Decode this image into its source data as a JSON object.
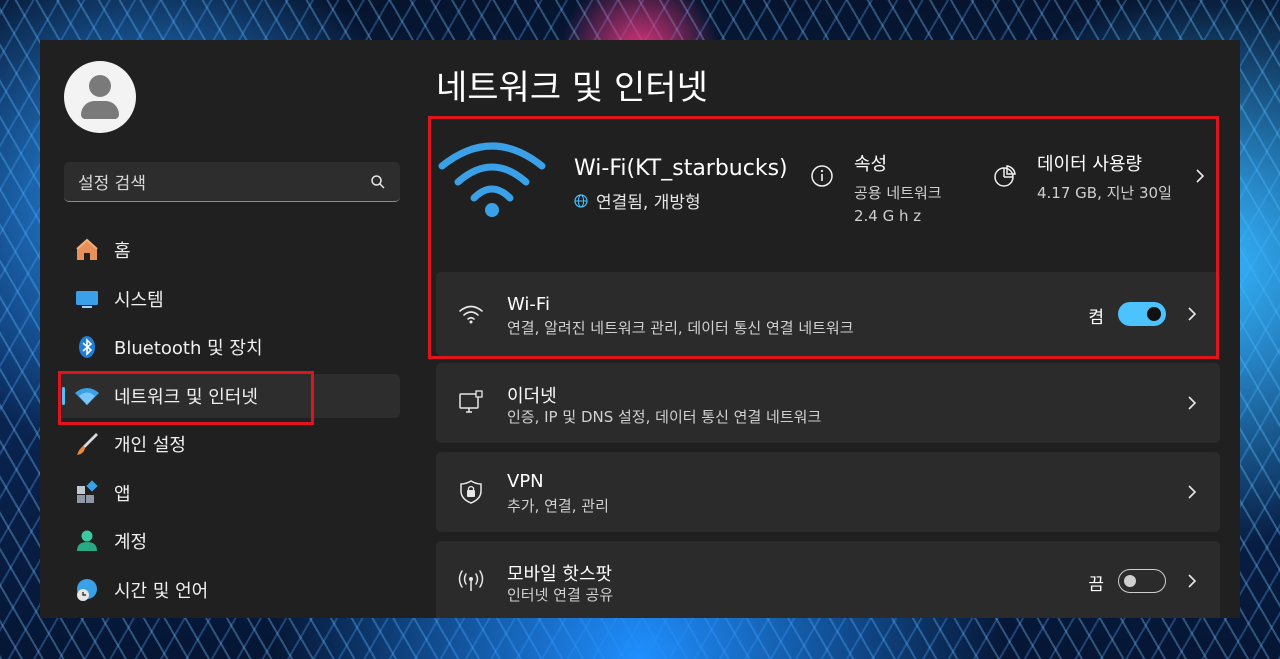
{
  "sidebar": {
    "search_placeholder": "설정 검색",
    "items": [
      {
        "label": "홈",
        "icon": "home-icon"
      },
      {
        "label": "시스템",
        "icon": "system-icon"
      },
      {
        "label": "Bluetooth 및 장치",
        "icon": "bluetooth-icon"
      },
      {
        "label": "네트워크 및 인터넷",
        "icon": "wifi-icon",
        "active": true
      },
      {
        "label": "개인 설정",
        "icon": "brush-icon"
      },
      {
        "label": "앱",
        "icon": "apps-icon"
      },
      {
        "label": "계정",
        "icon": "account-icon"
      },
      {
        "label": "시간 및 언어",
        "icon": "clock-globe-icon"
      }
    ]
  },
  "main": {
    "title": "네트워크 및 인터넷",
    "connection": {
      "name": "Wi-Fi(KT_starbucks)",
      "status": "연결됨, 개방형",
      "properties_title": "속성",
      "properties_line1": "공용 네트워크",
      "properties_line2": "2.4 G h z",
      "data_usage_title": "데이터 사용량",
      "data_usage_value": "4.17 GB, 지난 30일"
    },
    "cards": [
      {
        "title": "Wi-Fi",
        "subtitle": "연결, 알려진 네트워크 관리, 데이터 통신 연결 네트워크",
        "toggle_label": "켬",
        "toggle_on": true
      },
      {
        "title": "이더넷",
        "subtitle": "인증, IP 및 DNS 설정, 데이터 통신 연결 네트워크"
      },
      {
        "title": "VPN",
        "subtitle": "추가, 연결, 관리"
      },
      {
        "title": "모바일 핫스팟",
        "subtitle": "인터넷 연결 공유",
        "toggle_label": "끔",
        "toggle_on": false
      }
    ]
  },
  "colors": {
    "accent": "#4cc2ff",
    "highlight": "#e0141e",
    "panel": "#202020",
    "card": "#2b2b2b"
  }
}
